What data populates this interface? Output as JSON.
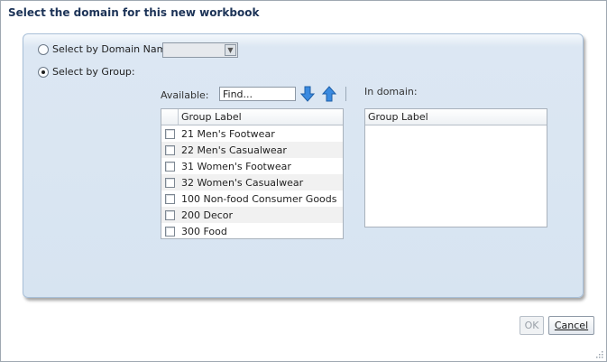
{
  "dialog": {
    "title": "Select the domain for this new workbook"
  },
  "options": {
    "by_domain_name": {
      "label": "Select by Domain Name:",
      "selected": false,
      "value": ""
    },
    "by_group": {
      "label": "Select by Group:",
      "selected": true
    }
  },
  "available": {
    "label": "Available:",
    "find_value": "Find...",
    "column_header": "Group Label",
    "items": [
      {
        "label": "21 Men's Footwear",
        "checked": false
      },
      {
        "label": "22 Men's Casualwear",
        "checked": false
      },
      {
        "label": "31 Women's Footwear",
        "checked": false
      },
      {
        "label": "32 Women's Casualwear",
        "checked": false
      },
      {
        "label": "100 Non-food Consumer Goods",
        "checked": false
      },
      {
        "label": "200 Decor",
        "checked": false
      },
      {
        "label": "300 Food",
        "checked": false
      }
    ]
  },
  "in_domain": {
    "label": "In domain:",
    "column_header": "Group Label",
    "items": []
  },
  "buttons": {
    "ok": "OK",
    "cancel": "Cancel"
  },
  "icons": {
    "move_down": "arrow-down-icon",
    "move_up": "arrow-up-icon",
    "dropdown": "chevron-down-icon",
    "resize": "resize-grip-icon"
  },
  "colors": {
    "panel": "#d7e4f1",
    "title": "#1c3357",
    "arrow": "#2f7fd6"
  }
}
